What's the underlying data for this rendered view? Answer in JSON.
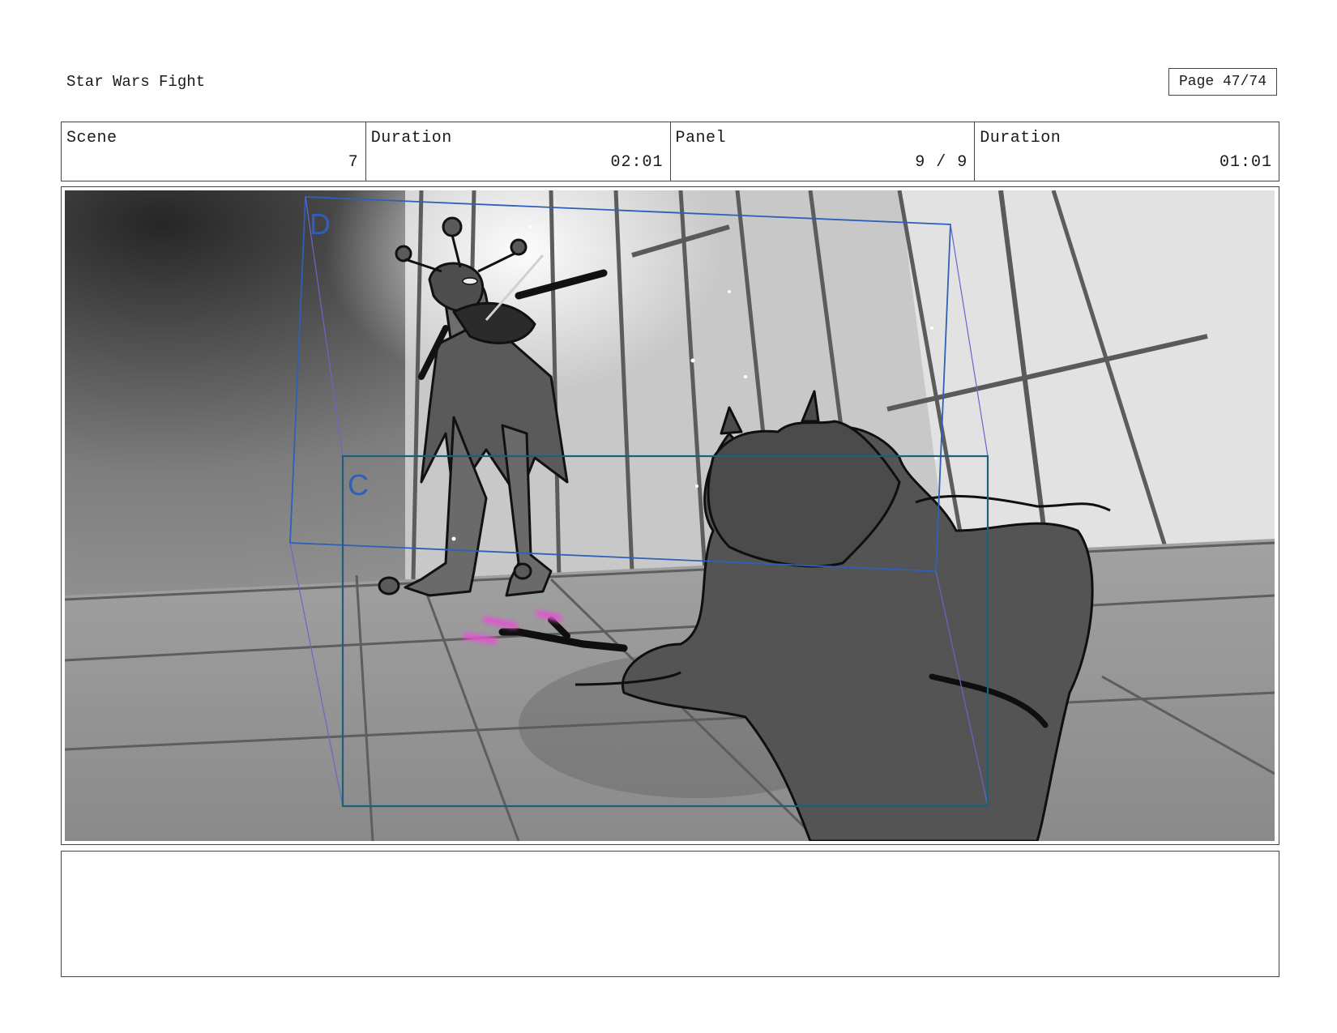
{
  "header": {
    "project_title": "Star Wars Fight",
    "page_number": "Page 47/74"
  },
  "info": {
    "scene_label": "Scene",
    "scene_value": "7",
    "scene_duration_label": "Duration",
    "scene_duration_value": "02:01",
    "panel_label": "Panel",
    "panel_value": "9 / 9",
    "panel_duration_label": "Duration",
    "panel_duration_value": "01:01"
  },
  "panel": {
    "camera_label_d": "D",
    "camera_label_c": "C",
    "colors": {
      "camera_frame_d": "#2f5fb8",
      "camera_frame_c": "#1f5f7a",
      "saber_glow": "#e255d0"
    }
  },
  "notes": {
    "text": ""
  }
}
